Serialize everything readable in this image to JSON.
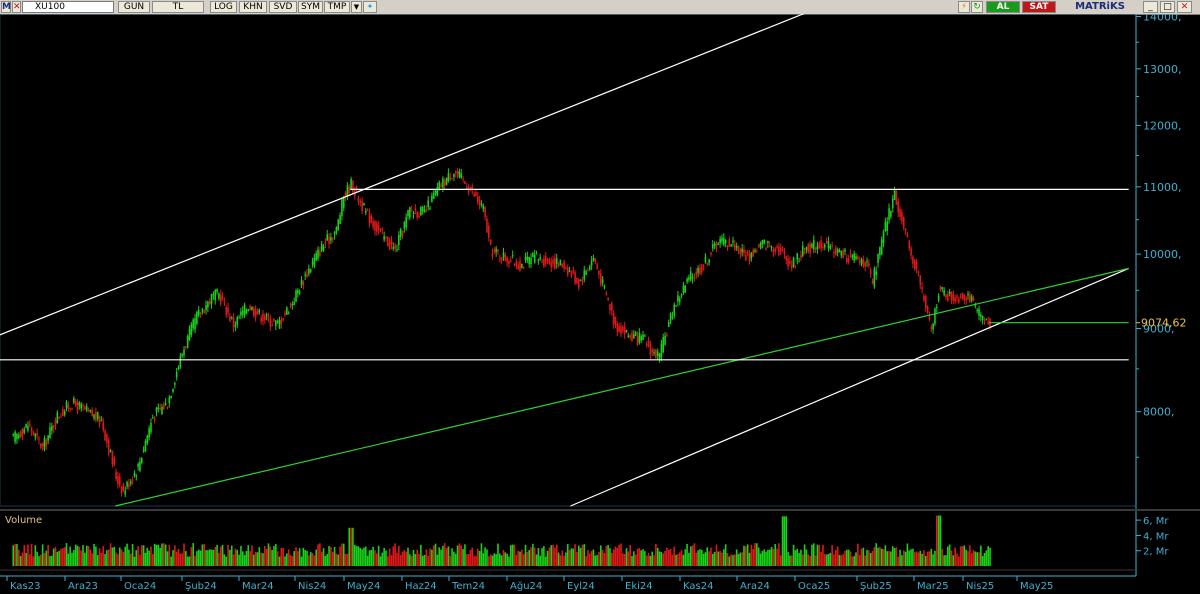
{
  "toolbar": {
    "app_icon": "M",
    "symbol": "XU100",
    "buttons": [
      "GUN",
      "TL",
      "LOG",
      "KHN",
      "SVD",
      "SYM",
      "TMP"
    ],
    "buy_label": "AL",
    "sell_label": "SAT",
    "brand": "MATRiKS",
    "colors": {
      "buy": "#1a9a1a",
      "sell": "#c01818"
    }
  },
  "chart_data": {
    "type": "candlestick",
    "price_axis": {
      "ticks": [
        14000,
        13000,
        12000,
        11000,
        10000,
        9000,
        8000
      ],
      "tick_labels": [
        "14000,",
        "13000,",
        "12000,",
        "11000,",
        "10000,",
        "9000,",
        "8000,"
      ],
      "scale": "log",
      "range": [
        7000,
        14050
      ]
    },
    "last_price": {
      "value": 9074.62,
      "label": "9074,62"
    },
    "x_axis": {
      "labels": [
        "Kas23",
        "Ara23",
        "Oca24",
        "Şub24",
        "Mar24",
        "Nis24",
        "May24",
        "Haz24",
        "Tem24",
        "Ağu24",
        "Eyl24",
        "Eki24",
        "Kas24",
        "Ara24",
        "Oca25",
        "Şub25",
        "Mar25",
        "Nis25",
        "May25"
      ]
    },
    "price_path": [
      [
        1,
        7700
      ],
      [
        3,
        7850
      ],
      [
        5,
        7600
      ],
      [
        7,
        7950
      ],
      [
        9,
        8100
      ],
      [
        11,
        8000
      ],
      [
        13,
        7900
      ],
      [
        15,
        7300
      ],
      [
        16,
        7150
      ],
      [
        18,
        7400
      ],
      [
        20,
        7950
      ],
      [
        22,
        8100
      ],
      [
        24,
        8700
      ],
      [
        26,
        9150
      ],
      [
        28,
        9400
      ],
      [
        29,
        9450
      ],
      [
        31,
        9050
      ],
      [
        33,
        9300
      ],
      [
        35,
        9150
      ],
      [
        37,
        9050
      ],
      [
        39,
        9350
      ],
      [
        41,
        9750
      ],
      [
        43,
        10100
      ],
      [
        45,
        10350
      ],
      [
        46,
        10850
      ],
      [
        47,
        11050
      ],
      [
        49,
        10600
      ],
      [
        51,
        10300
      ],
      [
        53,
        10050
      ],
      [
        55,
        10650
      ],
      [
        57,
        10600
      ],
      [
        59,
        11000
      ],
      [
        61,
        11250
      ],
      [
        63,
        11000
      ],
      [
        65,
        10650
      ],
      [
        66,
        10050
      ],
      [
        68,
        9950
      ],
      [
        70,
        9850
      ],
      [
        72,
        9950
      ],
      [
        74,
        9900
      ],
      [
        76,
        9850
      ],
      [
        78,
        9600
      ],
      [
        80,
        9950
      ],
      [
        82,
        9350
      ],
      [
        83,
        9050
      ],
      [
        85,
        8900
      ],
      [
        87,
        8850
      ],
      [
        88,
        8700
      ],
      [
        89,
        8650
      ],
      [
        91,
        9300
      ],
      [
        93,
        9650
      ],
      [
        95,
        9850
      ],
      [
        97,
        10200
      ],
      [
        99,
        10150
      ],
      [
        101,
        9950
      ],
      [
        103,
        10150
      ],
      [
        105,
        10100
      ],
      [
        107,
        9850
      ],
      [
        109,
        10100
      ],
      [
        111,
        10150
      ],
      [
        113,
        10050
      ],
      [
        115,
        9950
      ],
      [
        117,
        9900
      ],
      [
        118,
        9600
      ],
      [
        120,
        10500
      ],
      [
        121,
        10900
      ],
      [
        123,
        10050
      ],
      [
        124,
        9800
      ],
      [
        126,
        8950
      ],
      [
        127,
        9500
      ],
      [
        129,
        9400
      ],
      [
        131,
        9450
      ],
      [
        132,
        9250
      ],
      [
        133,
        9100
      ],
      [
        134,
        9074.62
      ]
    ],
    "volume": {
      "label": "Volume",
      "ticks": [
        6,
        4,
        2
      ],
      "tick_labels": [
        "6, Mr",
        "4, Mr",
        "2, Mr"
      ],
      "range": [
        0,
        6.8
      ],
      "peaks": [
        [
          106,
          6.5
        ],
        [
          127,
          6.6
        ],
        [
          47,
          5.0
        ]
      ]
    },
    "trendlines": [
      {
        "name": "upper-channel",
        "color": "#ffffff",
        "from": [
          -1.5,
          8890
        ],
        "to": [
          109.5,
          14100
        ]
      },
      {
        "name": "lower-channel",
        "color": "#ffffff",
        "from": [
          77,
          7000
        ],
        "to": [
          153,
          9800
        ]
      },
      {
        "name": "support-trendline",
        "color": "#30d030",
        "from": [
          15,
          7000
        ],
        "to": [
          153,
          9800
        ]
      },
      {
        "name": "resistance-horizontal",
        "color": "#ffffff",
        "from": [
          47,
          10960
        ],
        "to": [
          153,
          10960
        ]
      },
      {
        "name": "support-horizontal",
        "color": "#ffffff",
        "from": [
          -1.5,
          8610
        ],
        "to": [
          153,
          8610
        ]
      },
      {
        "name": "last-price-line",
        "color": "#30d030",
        "from": [
          134,
          9074.62
        ],
        "to": [
          153,
          9074.62
        ]
      }
    ],
    "colors": {
      "up": "#19d219",
      "down": "#e01818",
      "axis": "#3fb0d0"
    },
    "grid": false
  }
}
